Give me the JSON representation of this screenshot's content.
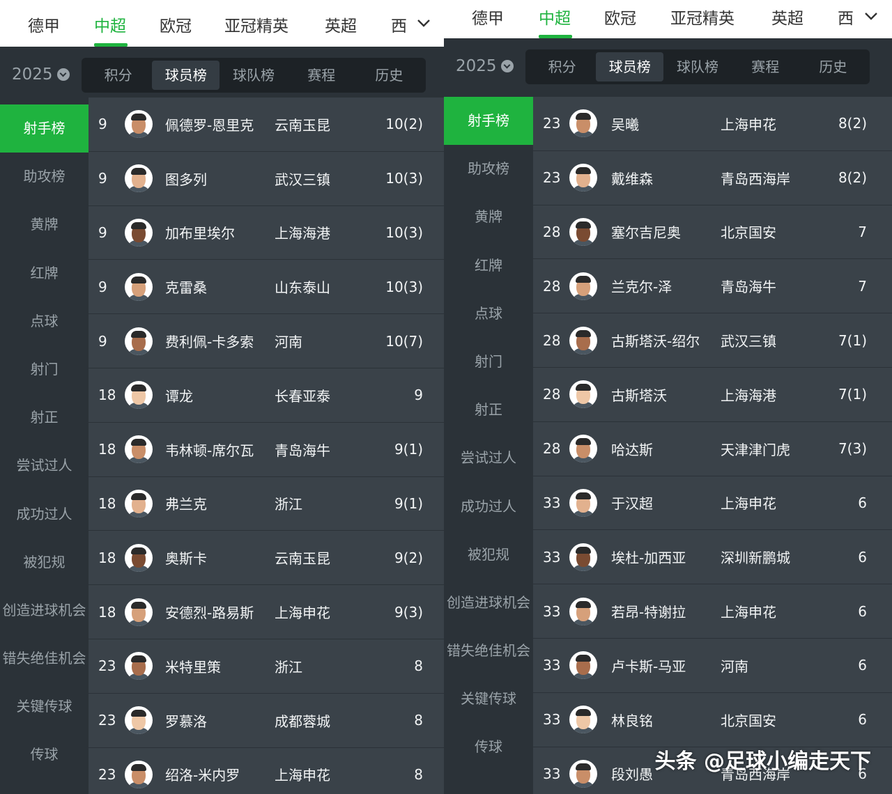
{
  "leagues": [
    "德甲",
    "中超",
    "欧冠",
    "亚冠精英",
    "英超",
    "西"
  ],
  "active_league": "中超",
  "year": "2025",
  "board_tabs": [
    "积分",
    "球员榜",
    "球队榜",
    "赛程",
    "历史"
  ],
  "active_board_tab": "球员榜",
  "stat_categories": [
    "射手榜",
    "助攻榜",
    "黄牌",
    "红牌",
    "点球",
    "射门",
    "射正",
    "尝试过人",
    "成功过人",
    "被犯规",
    "创造进球机会",
    "错失绝佳机会",
    "关键传球",
    "传球"
  ],
  "active_stat": "射手榜",
  "left_rows": [
    {
      "rank": "9",
      "name": "佩德罗-恩里克",
      "team": "云南玉昆",
      "goals": "10(2)"
    },
    {
      "rank": "9",
      "name": "图多列",
      "team": "武汉三镇",
      "goals": "10(3)"
    },
    {
      "rank": "9",
      "name": "加布里埃尔",
      "team": "上海海港",
      "goals": "10(3)"
    },
    {
      "rank": "9",
      "name": "克雷桑",
      "team": "山东泰山",
      "goals": "10(3)"
    },
    {
      "rank": "9",
      "name": "费利佩-卡多索",
      "team": "河南",
      "goals": "10(7)"
    },
    {
      "rank": "18",
      "name": "谭龙",
      "team": "长春亚泰",
      "goals": "9"
    },
    {
      "rank": "18",
      "name": "韦林顿-席尔瓦",
      "team": "青岛海牛",
      "goals": "9(1)"
    },
    {
      "rank": "18",
      "name": "弗兰克",
      "team": "浙江",
      "goals": "9(1)"
    },
    {
      "rank": "18",
      "name": "奥斯卡",
      "team": "云南玉昆",
      "goals": "9(2)"
    },
    {
      "rank": "18",
      "name": "安德烈-路易斯",
      "team": "上海申花",
      "goals": "9(3)"
    },
    {
      "rank": "23",
      "name": "米特里策",
      "team": "浙江",
      "goals": "8"
    },
    {
      "rank": "23",
      "name": "罗慕洛",
      "team": "成都蓉城",
      "goals": "8"
    },
    {
      "rank": "23",
      "name": "绍洛-米内罗",
      "team": "上海申花",
      "goals": "8"
    }
  ],
  "right_rows": [
    {
      "rank": "23",
      "name": "吴曦",
      "team": "上海申花",
      "goals": "8(2)"
    },
    {
      "rank": "23",
      "name": "戴维森",
      "team": "青岛西海岸",
      "goals": "8(2)"
    },
    {
      "rank": "28",
      "name": "塞尔吉尼奥",
      "team": "北京国安",
      "goals": "7"
    },
    {
      "rank": "28",
      "name": "兰克尔-泽",
      "team": "青岛海牛",
      "goals": "7"
    },
    {
      "rank": "28",
      "name": "古斯塔沃-绍尔",
      "team": "武汉三镇",
      "goals": "7(1)"
    },
    {
      "rank": "28",
      "name": "古斯塔沃",
      "team": "上海海港",
      "goals": "7(1)"
    },
    {
      "rank": "28",
      "name": "哈达斯",
      "team": "天津津门虎",
      "goals": "7(3)"
    },
    {
      "rank": "33",
      "name": "于汉超",
      "team": "上海申花",
      "goals": "6"
    },
    {
      "rank": "33",
      "name": "埃杜-加西亚",
      "team": "深圳新鹏城",
      "goals": "6"
    },
    {
      "rank": "33",
      "name": "若昂-特谢拉",
      "team": "上海申花",
      "goals": "6"
    },
    {
      "rank": "33",
      "name": "卢卡斯-马亚",
      "team": "河南",
      "goals": "6"
    },
    {
      "rank": "33",
      "name": "林良铭",
      "team": "北京国安",
      "goals": "6"
    },
    {
      "rank": "33",
      "name": "段刘愚",
      "team": "青岛西海岸",
      "goals": "6"
    }
  ],
  "watermark": "头条 @足球小编走天下",
  "colors": {
    "accent": "#1fb33f",
    "background": "#2b3238",
    "row": "#3a4249",
    "segment": "#1d2226"
  }
}
